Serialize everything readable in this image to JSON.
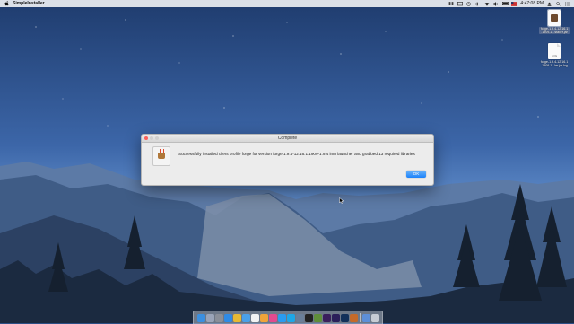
{
  "menubar": {
    "app_name": "SimpleInstaller",
    "clock": "4:47:08 PM",
    "status_icons": [
      "dropbox-icon",
      "display-icon",
      "time-machine-icon",
      "bluetooth-icon",
      "wifi-icon",
      "volume-icon",
      "battery-icon",
      "flag-icon",
      "user-icon",
      "spotlight-icon",
      "notification-center-icon"
    ]
  },
  "desktop_files": [
    {
      "name_line1": "forge-1.9.4-12.16.1",
      "name_line2": ".1909-1...staller.jar",
      "type": "jar",
      "selected": true
    },
    {
      "name_line1": "forge-1.9.4-12.16.1",
      "name_line2": ".1909-1...ler.jar.log",
      "type": "log",
      "ext": "LOG",
      "selected": false
    }
  ],
  "dialog": {
    "title": "Complete",
    "message": "Successfully installed client profile forge for version forge 1.9.4-12.16.1.1909-1.9.4 into launcher and grabbed 13 required libraries",
    "ok_label": "OK"
  },
  "dock": {
    "apps": [
      {
        "name": "finder-icon",
        "color": "#3b8fe0"
      },
      {
        "name": "launchpad-icon",
        "color": "#9aa4b8"
      },
      {
        "name": "system-preferences-icon",
        "color": "#8a8f99"
      },
      {
        "name": "safari-icon",
        "color": "#2f8be6"
      },
      {
        "name": "chrome-icon",
        "color": "#e6b934"
      },
      {
        "name": "mail-icon",
        "color": "#4aa0e8"
      },
      {
        "name": "calendar-icon",
        "color": "#f2f2f2"
      },
      {
        "name": "photos-icon",
        "color": "#f0a43a"
      },
      {
        "name": "itunes-icon",
        "color": "#e24a8f"
      },
      {
        "name": "app-store-icon",
        "color": "#2a9bf0"
      },
      {
        "name": "skype-icon",
        "color": "#1ea7e6"
      },
      {
        "name": "preview-icon",
        "color": "#6a7f99"
      },
      {
        "name": "terminal-icon",
        "color": "#222222"
      },
      {
        "name": "minecraft-icon",
        "color": "#5f8e3a"
      },
      {
        "name": "premiere-icon",
        "color": "#3a1f5c"
      },
      {
        "name": "after-effects-icon",
        "color": "#2b1f5a"
      },
      {
        "name": "photoshop-icon",
        "color": "#12305a"
      },
      {
        "name": "java-icon",
        "color": "#c46a2a"
      }
    ],
    "utilities": [
      {
        "name": "downloads-icon",
        "color": "#5d8fd8"
      },
      {
        "name": "trash-icon",
        "color": "#c7ccd4"
      }
    ]
  }
}
